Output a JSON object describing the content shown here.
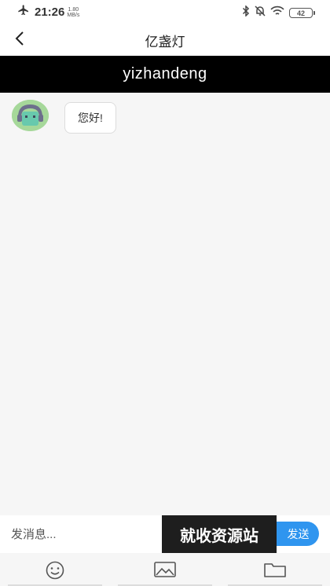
{
  "status": {
    "time": "21:26",
    "net_speed_value": "1.80",
    "net_speed_unit": "MB/s",
    "battery": "42",
    "icons": [
      "airplane-icon",
      "bluetooth-icon",
      "mute-icon",
      "wifi-icon",
      "battery-icon"
    ]
  },
  "nav": {
    "title": "亿盏灯",
    "back_icon": "chevron-left-icon"
  },
  "banner": {
    "text": "yizhandeng"
  },
  "chat": {
    "messages": [
      {
        "sender": "bot",
        "avatar_icon": "bot-avatar-icon",
        "text": "您好!"
      }
    ]
  },
  "input": {
    "placeholder": "发消息...",
    "send_label": "发送"
  },
  "watermark": {
    "text": "就收资源站"
  },
  "toolbar": {
    "items": [
      "emoji-icon",
      "image-icon",
      "folder-icon"
    ]
  },
  "colors": {
    "banner_bg": "#000000",
    "send_button": "#2f95ef",
    "avatar_bg": "#a6d89a",
    "avatar_face": "#68c9ad",
    "avatar_hair": "#6d6f8c"
  }
}
